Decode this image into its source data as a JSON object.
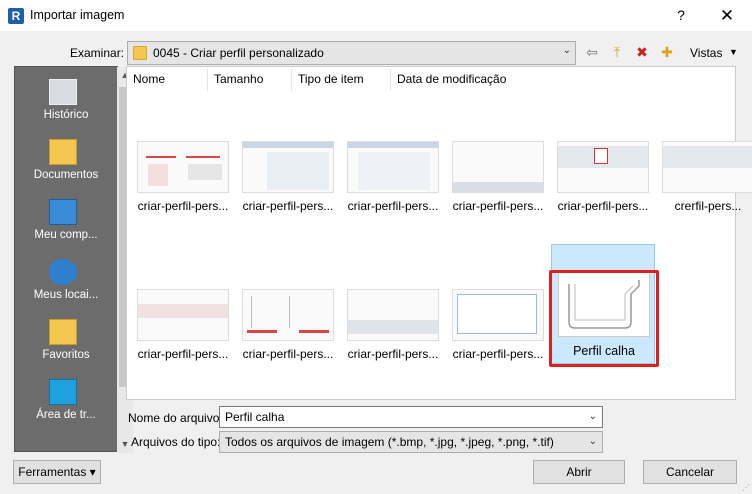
{
  "window": {
    "title": "Importar imagem",
    "help_label": "?",
    "close_label": "✕"
  },
  "toolbar": {
    "examinar_label": "Examinar:",
    "current_folder": "0045 - Criar perfil personalizado",
    "back_icon": "⇦",
    "up_folder_icon": "⤒",
    "delete_icon": "✖",
    "new_folder_icon": "✚",
    "views_label": "Vistas",
    "views_arrow": "▼",
    "combo_arrow": "⌄"
  },
  "places": [
    {
      "label": "Histórico",
      "icon": "history-icon"
    },
    {
      "label": "Documentos",
      "icon": "documents-icon"
    },
    {
      "label": "Meu comp...",
      "icon": "computer-icon"
    },
    {
      "label": "Meus locai...",
      "icon": "network-icon"
    },
    {
      "label": "Favoritos",
      "icon": "favorites-icon"
    },
    {
      "label": "Área de tr...",
      "icon": "desktop-icon"
    }
  ],
  "places_scroll": {
    "up": "▲",
    "down": "▼"
  },
  "columns": [
    "Nome",
    "Tamanho",
    "Tipo de item",
    "Data de modificação"
  ],
  "files": [
    {
      "name": "criar-perfil-pers..."
    },
    {
      "name": "criar-perfil-pers..."
    },
    {
      "name": "criar-perfil-pers..."
    },
    {
      "name": "criar-perfil-pers..."
    },
    {
      "name": "criar-perfil-pers..."
    },
    {
      "name": "crerfil-pers..."
    },
    {
      "name": "criar-perfil-pers..."
    },
    {
      "name": "criar-perfil-pers..."
    },
    {
      "name": "criar-perfil-pers..."
    },
    {
      "name": "criar-perfil-pers..."
    },
    {
      "name": "Perfil calha",
      "selected": true
    }
  ],
  "form": {
    "filename_label": "Nome do arquivo:",
    "filename_value": "Perfil calha",
    "filetype_label": "Arquivos do tipo:",
    "filetype_value": "Todos os arquivos de imagem (*.bmp, *.jpg, *.jpeg, *.png, *.tif)",
    "dropdown_arrow": "⌄"
  },
  "buttons": {
    "tools": "Ferramentas",
    "tools_arrow": "▾",
    "open": "Abrir",
    "cancel": "Cancelar"
  },
  "colors": {
    "selection": "#cce8ff",
    "highlight_border": "#e02020",
    "places_bg": "#6c6c6c"
  }
}
